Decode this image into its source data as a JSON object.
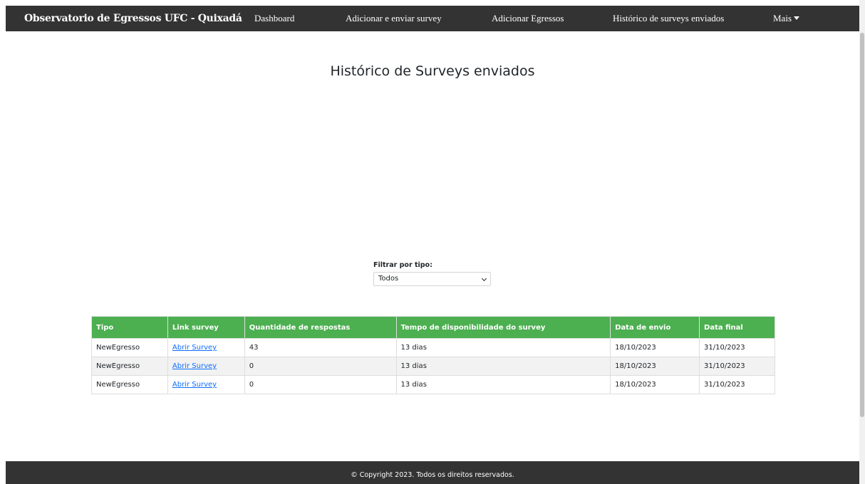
{
  "navbar": {
    "brand": "Observatorio de Egressos UFC - Quixadá",
    "links": [
      {
        "label": "Dashboard"
      },
      {
        "label": "Adicionar e enviar survey"
      },
      {
        "label": "Adicionar Egressos"
      },
      {
        "label": "Histórico de surveys enviados"
      },
      {
        "label": "Mais"
      }
    ]
  },
  "page": {
    "title": "Histórico de Surveys enviados"
  },
  "filter": {
    "label": "Filtrar por tipo:",
    "selected": "Todos"
  },
  "table": {
    "headers": [
      "Tipo",
      "Link survey",
      "Quantidade de respostas",
      "Tempo de disponibilidade do survey",
      "Data de envio",
      "Data final"
    ],
    "rows": [
      {
        "tipo": "NewEgresso",
        "link": "Abrir Survey",
        "respostas": "43",
        "tempo": "13 dias",
        "envio": "18/10/2023",
        "final": "31/10/2023"
      },
      {
        "tipo": "NewEgresso",
        "link": "Abrir Survey",
        "respostas": "0",
        "tempo": "13 dias",
        "envio": "18/10/2023",
        "final": "31/10/2023"
      },
      {
        "tipo": "NewEgresso",
        "link": "Abrir Survey",
        "respostas": "0",
        "tempo": "13 dias",
        "envio": "18/10/2023",
        "final": "31/10/2023"
      }
    ]
  },
  "footer": {
    "text": "© Copyright 2023. Todos os direitos reservados."
  },
  "colors": {
    "navbar_bg": "#333333",
    "table_header_bg": "#4caf50",
    "link": "#0d6efd"
  }
}
